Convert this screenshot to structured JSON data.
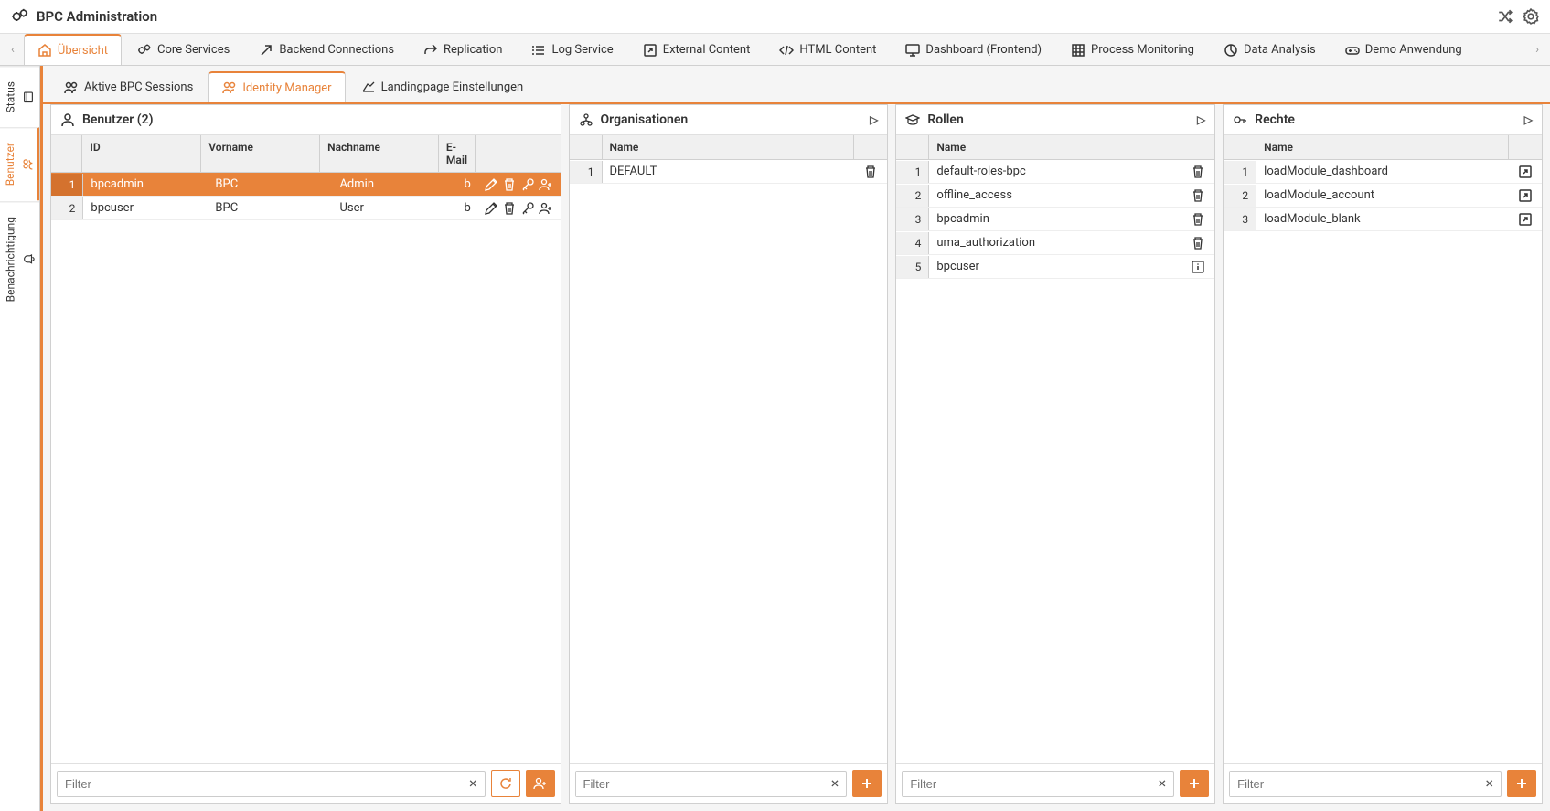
{
  "header": {
    "title": "BPC Administration"
  },
  "nav": {
    "items": [
      {
        "label": "Übersicht",
        "active": true
      },
      {
        "label": "Core Services"
      },
      {
        "label": "Backend Connections"
      },
      {
        "label": "Replication"
      },
      {
        "label": "Log Service"
      },
      {
        "label": "External Content"
      },
      {
        "label": "HTML Content"
      },
      {
        "label": "Dashboard (Frontend)"
      },
      {
        "label": "Process Monitoring"
      },
      {
        "label": "Data Analysis"
      },
      {
        "label": "Demo Anwendung"
      }
    ]
  },
  "sidebar": {
    "items": [
      {
        "label": "Status"
      },
      {
        "label": "Benutzer",
        "active": true
      },
      {
        "label": "Benachrichtigung"
      }
    ]
  },
  "subtabs": {
    "items": [
      {
        "label": "Aktive BPC Sessions"
      },
      {
        "label": "Identity Manager",
        "active": true
      },
      {
        "label": "Landingpage Einstellungen"
      }
    ]
  },
  "panels": {
    "users": {
      "title": "Benutzer (2)",
      "columns": {
        "id": "ID",
        "vorname": "Vorname",
        "nachname": "Nachname",
        "email": "E-Mail"
      },
      "rows": [
        {
          "num": "1",
          "id": "bpcadmin",
          "vorname": "BPC",
          "nachname": "Admin",
          "email": "bpcadmin@example.c...",
          "selected": true
        },
        {
          "num": "2",
          "id": "bpcuser",
          "vorname": "BPC",
          "nachname": "User",
          "email": "bpcuser@example.com"
        }
      ],
      "filter_placeholder": "Filter"
    },
    "orgs": {
      "title": "Organisationen",
      "columns": {
        "name": "Name"
      },
      "rows": [
        {
          "num": "1",
          "name": "DEFAULT"
        }
      ],
      "filter_placeholder": "Filter"
    },
    "roles": {
      "title": "Rollen",
      "columns": {
        "name": "Name"
      },
      "rows": [
        {
          "num": "1",
          "name": "default-roles-bpc",
          "icon": "trash"
        },
        {
          "num": "2",
          "name": "offline_access",
          "icon": "trash"
        },
        {
          "num": "3",
          "name": "bpcadmin",
          "icon": "trash"
        },
        {
          "num": "4",
          "name": "uma_authorization",
          "icon": "trash"
        },
        {
          "num": "5",
          "name": "bpcuser",
          "icon": "info"
        }
      ],
      "filter_placeholder": "Filter"
    },
    "rights": {
      "title": "Rechte",
      "columns": {
        "name": "Name"
      },
      "rows": [
        {
          "num": "1",
          "name": "loadModule_dashboard"
        },
        {
          "num": "2",
          "name": "loadModule_account"
        },
        {
          "num": "3",
          "name": "loadModule_blank"
        }
      ],
      "filter_placeholder": "Filter"
    }
  }
}
